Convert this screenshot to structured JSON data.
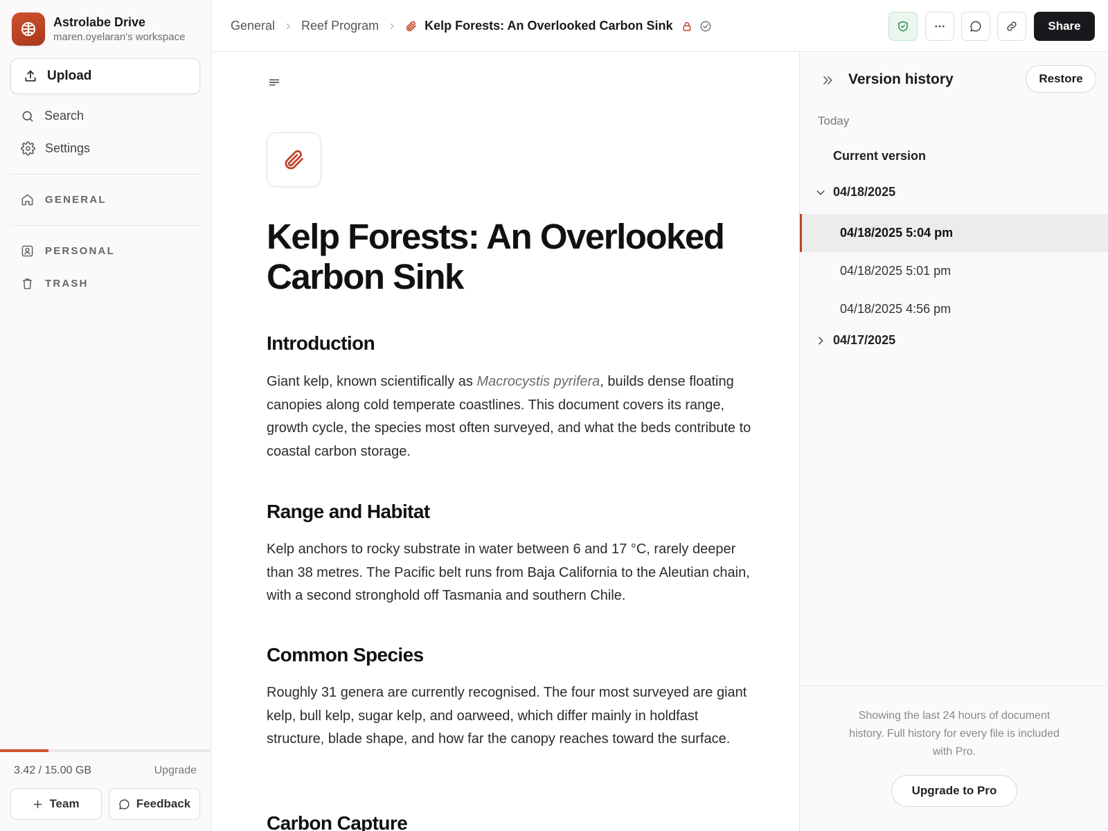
{
  "workspace": {
    "name": "Astrolabe Drive",
    "subtitle": "maren.oyelaran's workspace",
    "logo_icon": "globe-icon"
  },
  "sidebar": {
    "upload_label": "Upload",
    "search_label": "Search",
    "settings_label": "Settings",
    "sections": {
      "general": "GENERAL",
      "personal": "PERSONAL",
      "trash": "TRASH"
    },
    "storage": {
      "text": "3.42 / 15.00 GB",
      "fraction_used": 0.228
    },
    "upgrade_label": "Upgrade",
    "team_label": "Team",
    "feedback_label": "Feedback"
  },
  "topbar": {
    "breadcrumb": [
      "General",
      "Reef Program"
    ],
    "doc_title": "Kelp Forests: An Overlooked Carbon Sink",
    "share_label": "Share",
    "icons": [
      "shield-check-icon",
      "more-icon",
      "comment-icon",
      "link-icon"
    ]
  },
  "document": {
    "title": "Kelp Forests: An Overlooked Carbon Sink",
    "sections": [
      {
        "heading": "Introduction",
        "text_before": "Giant kelp, known scientifically as ",
        "italic": "Macrocystis pyrifera",
        "text_after": ", builds dense floating canopies along cold temperate coastlines. This document covers its range, growth cycle, the species most often surveyed, and what the beds contribute to coastal carbon storage."
      },
      {
        "heading": "Range and Habitat",
        "text": "Kelp anchors to rocky substrate in water between 6 and 17 °C, rarely deeper than 38 metres. The Pacific belt runs from Baja California to the Aleutian chain, with a second stronghold off Tasmania and southern Chile."
      },
      {
        "heading": "Common Species",
        "text": "Roughly 31 genera are currently recognised. The four most surveyed are giant kelp, bull kelp, sugar kelp, and oarweed, which differ mainly in holdfast structure, blade shape, and how far the canopy reaches toward the surface."
      },
      {
        "heading": "Carbon Capture"
      }
    ]
  },
  "version_history": {
    "title": "Version history",
    "restore_label": "Restore",
    "today_label": "Today",
    "current_label": "Current version",
    "groups": [
      {
        "date": "04/18/2025",
        "expanded": true,
        "entries": [
          "04/18/2025 5:04 pm",
          "04/18/2025 5:01 pm",
          "04/18/2025 4:56 pm"
        ],
        "selected_index": 0
      },
      {
        "date": "04/17/2025",
        "expanded": false,
        "entries": []
      }
    ],
    "footer_note": "Showing the last 24 hours of document history. Full history for every file is included with Pro.",
    "upgrade_pro_label": "Upgrade to Pro"
  },
  "colors": {
    "accent": "#c0432a",
    "share_bg": "#17191c",
    "shield_bg": "#eaf6ee"
  }
}
